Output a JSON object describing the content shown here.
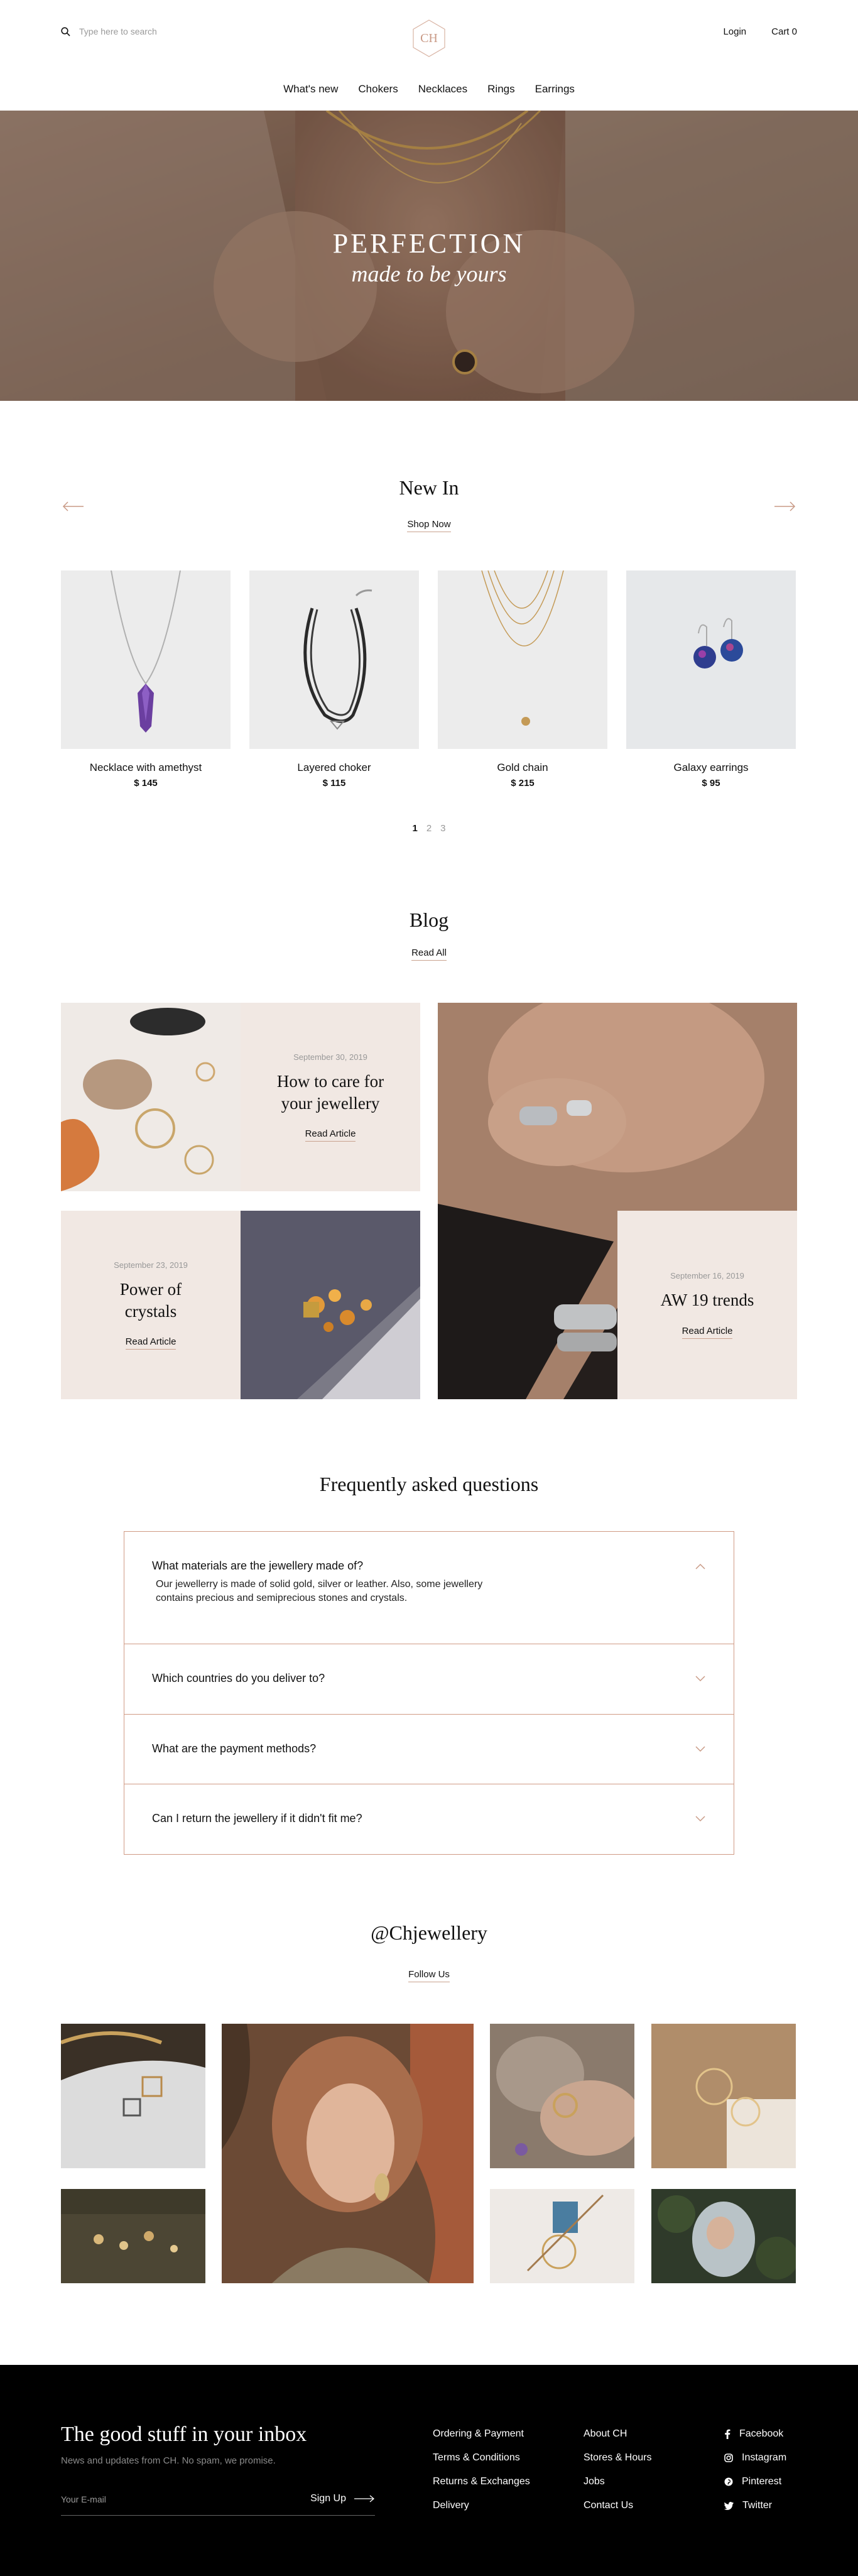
{
  "header": {
    "search_placeholder": "Type here to search",
    "logo_text": "CH",
    "login": "Login",
    "cart": "Cart 0",
    "nav": [
      "What's new",
      "Chokers",
      "Necklaces",
      "Rings",
      "Earrings"
    ]
  },
  "hero": {
    "title": "PERFECTION",
    "subtitle": "made to be yours"
  },
  "new_in": {
    "title": "New In",
    "link": "Shop Now",
    "products": [
      {
        "name": "Necklace with amethyst",
        "price": "$ 145"
      },
      {
        "name": "Layered choker",
        "price": "$ 115"
      },
      {
        "name": "Gold chain",
        "price": "$ 215"
      },
      {
        "name": "Galaxy earrings",
        "price": "$ 95"
      }
    ],
    "pages": [
      "1",
      "2",
      "3"
    ]
  },
  "blog": {
    "title": "Blog",
    "link": "Read All",
    "posts": [
      {
        "date": "September 30, 2019",
        "title": "How to care for your jewellery",
        "link": "Read Article"
      },
      {
        "date": "September 23, 2019",
        "title": "Power of crystals",
        "link": "Read Article"
      },
      {
        "date": "September 16, 2019",
        "title": "AW 19 trends",
        "link": "Read Article"
      }
    ]
  },
  "faq": {
    "title": "Frequently asked questions",
    "items": [
      {
        "q": "What materials are the jewellery made of?",
        "a": "Our jewellerry is made of solid gold, silver or leather.  Also, some jewellery contains precious and semiprecious stones and crystals."
      },
      {
        "q": "Which countries do you deliver to?"
      },
      {
        "q": "What are the payment methods?"
      },
      {
        "q": "Can I return the jewellery if it didn't fit me?"
      }
    ]
  },
  "instagram": {
    "handle": "@Chjewellery",
    "link": "Follow Us"
  },
  "footer": {
    "title": "The good stuff in your inbox",
    "subtitle": "News and updates from CH. No spam, we promise.",
    "email_placeholder": "Your E-mail",
    "signup": "Sign Up",
    "col1": [
      "Ordering & Payment",
      "Terms & Conditions",
      "Returns & Exchanges",
      "Delivery"
    ],
    "col2": [
      "About CH",
      "Stores & Hours",
      "Jobs",
      "Contact Us"
    ],
    "social": [
      "Facebook",
      "Instagram",
      "Pinterest",
      "Twitter"
    ]
  },
  "colors": {
    "accent": "#c99a86",
    "blog_bg": "#f1e8e3",
    "footer_bg": "#000000"
  }
}
